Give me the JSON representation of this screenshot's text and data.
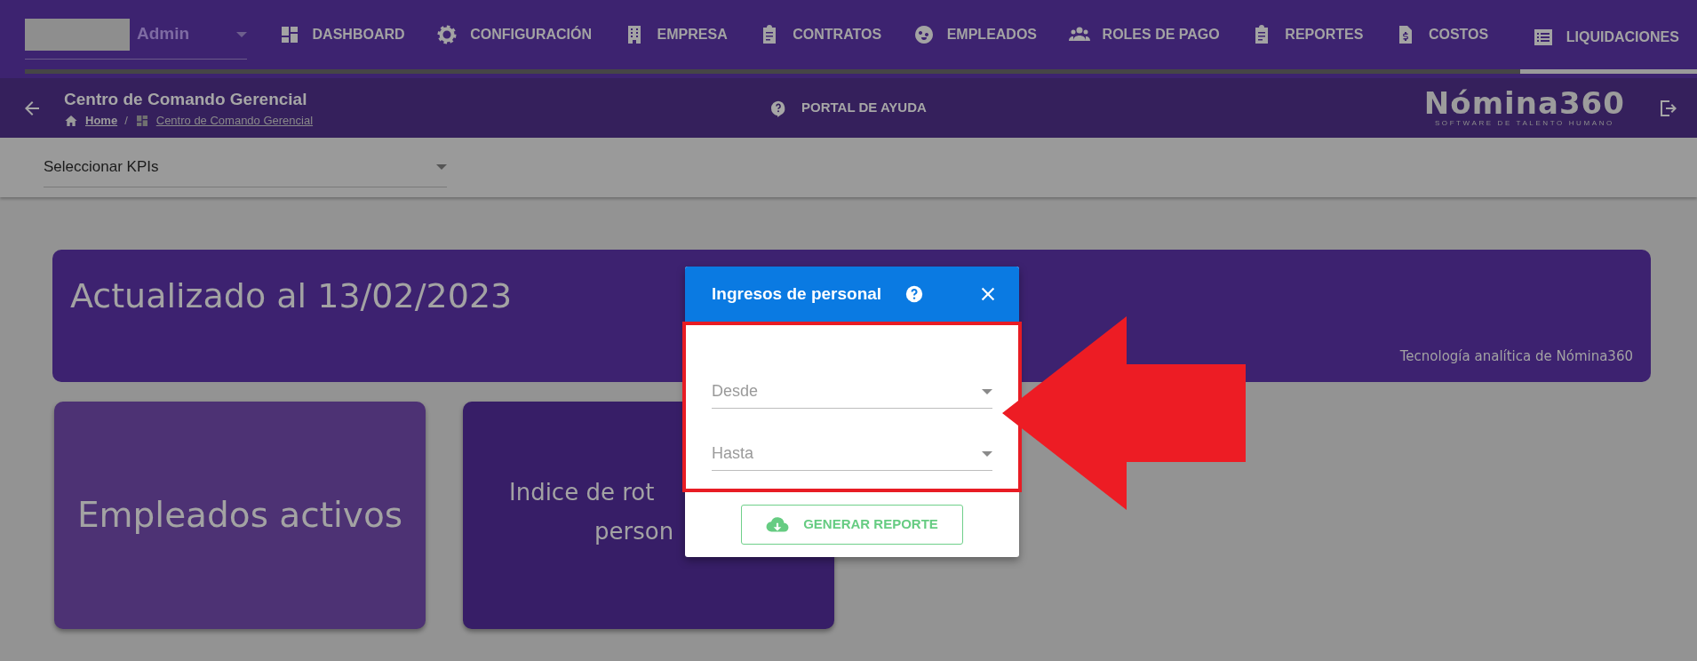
{
  "user": {
    "name": "Admin"
  },
  "nav_tabs": [
    {
      "label": "DASHBOARD",
      "kind": "dashboard",
      "selected": false
    },
    {
      "label": "CONFIGURACIÓN",
      "kind": "gear",
      "selected": false
    },
    {
      "label": "EMPRESA",
      "kind": "building",
      "selected": false
    },
    {
      "label": "CONTRATOS",
      "kind": "clipboard",
      "selected": false
    },
    {
      "label": "EMPLEADOS",
      "kind": "face",
      "selected": false
    },
    {
      "label": "ROLES DE PAGO",
      "kind": "people",
      "selected": false
    },
    {
      "label": "REPORTES",
      "kind": "clipboard",
      "selected": false
    },
    {
      "label": "COSTOS",
      "kind": "invoice",
      "selected": false
    },
    {
      "label": "LIQUIDACIONES",
      "kind": "list",
      "selected": true
    }
  ],
  "header": {
    "title": "Centro de Comando Gerencial",
    "breadcrumb_separator": "/",
    "breadcrumb": [
      {
        "label": "Home",
        "kind": "home"
      },
      {
        "label": "Centro de Comando Gerencial",
        "kind": "dashboard"
      }
    ],
    "help_link": "PORTAL DE AYUDA",
    "logo": {
      "name": "Nómina360",
      "tagline": "SOFTWARE DE TALENTO HUMANO"
    }
  },
  "kpi_select": {
    "value": "Seleccionar KPIs"
  },
  "banner": {
    "title": "Actualizado al 13/02/2023",
    "footer": "Tecnología analítica de Nómina360"
  },
  "cards": [
    {
      "lines": [
        "Empleados activos"
      ]
    },
    {
      "lines": [
        "Indice de rot",
        "person"
      ]
    }
  ],
  "dialog": {
    "title": "Ingresos de personal",
    "fields": [
      {
        "placeholder": "Desde"
      },
      {
        "placeholder": "Hasta"
      }
    ],
    "button": "GENERAR REPORTE"
  }
}
